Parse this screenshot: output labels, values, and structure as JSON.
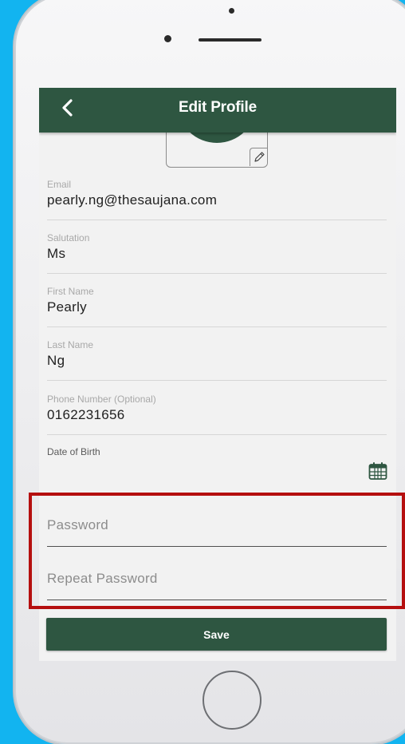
{
  "navbar": {
    "title": "Edit Profile",
    "back_icon": "chevron-left-icon",
    "color": "#2e5641"
  },
  "avatar": {
    "edit_icon": "pencil-icon"
  },
  "form": {
    "email": {
      "label": "Email",
      "value": "pearly.ng@thesaujana.com"
    },
    "salutation": {
      "label": "Salutation",
      "value": "Ms"
    },
    "first_name": {
      "label": "First Name",
      "value": "Pearly"
    },
    "last_name": {
      "label": "Last Name",
      "value": "Ng"
    },
    "phone": {
      "label": "Phone Number (Optional)",
      "value": "0162231656"
    },
    "dob": {
      "label": "Date of Birth",
      "value": "",
      "icon": "calendar-icon"
    },
    "password": {
      "placeholder": "Password",
      "value": ""
    },
    "repeat_password": {
      "placeholder": "Repeat Password",
      "value": ""
    }
  },
  "save_button": {
    "label": "Save"
  },
  "colors": {
    "background": "#12b4f0",
    "brand_green": "#2e5641",
    "highlight": "#b50f0f"
  }
}
